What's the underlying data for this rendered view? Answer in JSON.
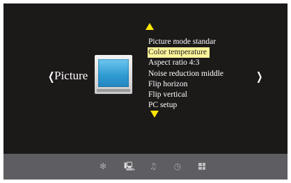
{
  "menu": {
    "category": "Picture",
    "left_arrow": "❮",
    "right_arrow": "❯",
    "items": [
      {
        "label": "Picture mode standar",
        "selected": false
      },
      {
        "label": "Color temperature",
        "selected": true
      },
      {
        "label": "Aspect ratio 4:3",
        "selected": false
      },
      {
        "label": "Noise reduction middle",
        "selected": false
      },
      {
        "label": "Flip horizon",
        "selected": false
      },
      {
        "label": "Flip vertical",
        "selected": false
      },
      {
        "label": "PC setup",
        "selected": false
      }
    ],
    "scroll_up_icon": "triangle-up-icon",
    "scroll_down_icon": "triangle-down-icon",
    "highlight_color": "#fff49a",
    "arrow_color": "#ffe600"
  },
  "footer": {
    "icons": [
      {
        "name": "sun-icon",
        "glyph": "✻",
        "active": false
      },
      {
        "name": "monitor-icon",
        "glyph": "🖳",
        "active": true
      },
      {
        "name": "music-note-icon",
        "glyph": "♫",
        "active": false
      },
      {
        "name": "clock-icon",
        "glyph": "◷",
        "active": false
      },
      {
        "name": "grid-icon",
        "glyph": "",
        "active": false
      }
    ]
  }
}
